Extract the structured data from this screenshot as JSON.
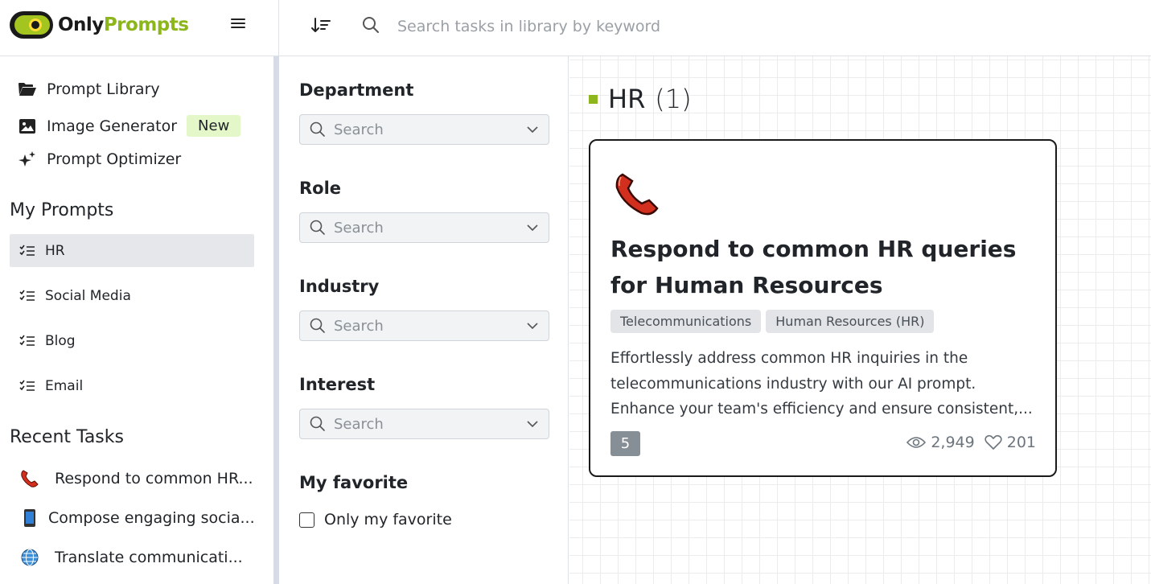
{
  "brand": {
    "name_part1": "Only",
    "name_part2": "Prompts",
    "accent": "#8db51c"
  },
  "search": {
    "placeholder": "Search tasks in library by keyword"
  },
  "sidebar": {
    "nav": [
      {
        "label": "Prompt Library",
        "icon": "folder-open-icon"
      },
      {
        "label": "Image Generator",
        "icon": "image-icon",
        "badge": "New"
      },
      {
        "label": "Prompt Optimizer",
        "icon": "sparkles-icon"
      }
    ],
    "my_prompts_heading": "My Prompts",
    "my_prompts": [
      {
        "label": "HR",
        "active": true
      },
      {
        "label": "Social Media"
      },
      {
        "label": "Blog"
      },
      {
        "label": "Email"
      }
    ],
    "recent_heading": "Recent Tasks",
    "recent": [
      {
        "label": "Respond to common HR...",
        "icon": "telephone-receiver-icon"
      },
      {
        "label": "Compose engaging socia...",
        "icon": "mobile-phone-icon"
      },
      {
        "label": "Translate communicati...",
        "icon": "globe-icon"
      }
    ]
  },
  "filters": {
    "department": {
      "label": "Department",
      "placeholder": "Search"
    },
    "role": {
      "label": "Role",
      "placeholder": "Search"
    },
    "industry": {
      "label": "Industry",
      "placeholder": "Search"
    },
    "interest": {
      "label": "Interest",
      "placeholder": "Search"
    },
    "favorite": {
      "label": "My favorite",
      "checkbox_label": "Only my favorite",
      "checked": false
    }
  },
  "main": {
    "group": {
      "title": "HR",
      "count": "(1)"
    },
    "card": {
      "title": "Respond to common HR queries for Human Resources",
      "tags": [
        "Telecommunications",
        "Human Resources (HR)"
      ],
      "description": "Effortlessly address common HR inquiries in the telecommunications industry with our AI prompt. Enhance your team's efficiency and ensure consistent,...",
      "prompt_count": "5",
      "views": "2,949",
      "likes": "201"
    }
  }
}
